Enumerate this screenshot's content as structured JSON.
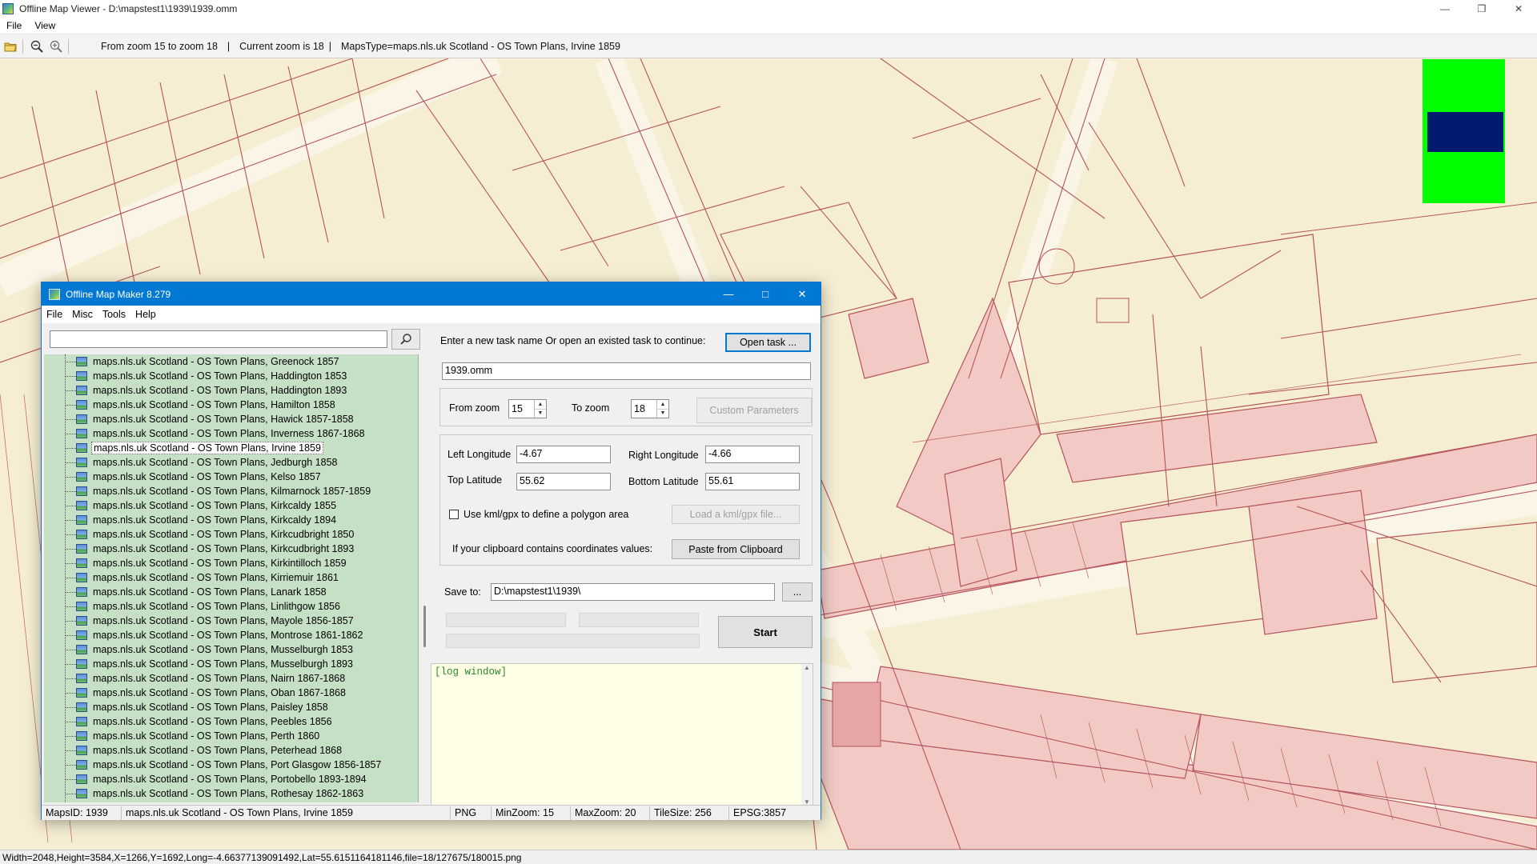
{
  "viewer": {
    "title": "Offline Map Viewer - D:\\mapstest1\\1939\\1939.omm",
    "menu": [
      "File",
      "View"
    ],
    "toolbar": {
      "zoom_range_text": "From zoom 15 to zoom 18",
      "current_zoom_text": "Current zoom is 18",
      "maps_type_text": "MapsType=maps.nls.uk Scotland - OS Town Plans, Irvine 1859",
      "separator": "|"
    },
    "status_bar": "Width=2048,Height=3584,X=1266,Y=1692,Long=-4.66377139091492,Lat=55.6151164181146,file=18/127675/180015.png"
  },
  "minimap": {
    "background_color": "#00ff00",
    "viewport_color": "#001a6e"
  },
  "dialog": {
    "title": "Offline Map Maker 8.279",
    "menu": [
      "File",
      "Misc",
      "Tools",
      "Help"
    ],
    "search": {
      "placeholder": "",
      "value": ""
    },
    "map_list": [
      "maps.nls.uk Scotland - OS Town Plans, Greenock 1857",
      "maps.nls.uk Scotland - OS Town Plans, Haddington 1853",
      "maps.nls.uk Scotland - OS Town Plans, Haddington 1893",
      "maps.nls.uk Scotland - OS Town Plans, Hamilton 1858",
      "maps.nls.uk Scotland - OS Town Plans, Hawick 1857-1858",
      "maps.nls.uk Scotland - OS Town Plans, Inverness 1867-1868",
      "maps.nls.uk Scotland - OS Town Plans, Irvine 1859",
      "maps.nls.uk Scotland - OS Town Plans, Jedburgh 1858",
      "maps.nls.uk Scotland - OS Town Plans, Kelso 1857",
      "maps.nls.uk Scotland - OS Town Plans, Kilmarnock 1857-1859",
      "maps.nls.uk Scotland - OS Town Plans, Kirkcaldy 1855",
      "maps.nls.uk Scotland - OS Town Plans, Kirkcaldy 1894",
      "maps.nls.uk Scotland - OS Town Plans, Kirkcudbright 1850",
      "maps.nls.uk Scotland - OS Town Plans, Kirkcudbright 1893",
      "maps.nls.uk Scotland - OS Town Plans, Kirkintilloch 1859",
      "maps.nls.uk Scotland - OS Town Plans, Kirriemuir 1861",
      "maps.nls.uk Scotland - OS Town Plans, Lanark 1858",
      "maps.nls.uk Scotland - OS Town Plans, Linlithgow 1856",
      "maps.nls.uk Scotland - OS Town Plans, Mayole 1856-1857",
      "maps.nls.uk Scotland - OS Town Plans, Montrose 1861-1862",
      "maps.nls.uk Scotland - OS Town Plans, Musselburgh 1853",
      "maps.nls.uk Scotland - OS Town Plans, Musselburgh 1893",
      "maps.nls.uk Scotland - OS Town Plans, Nairn 1867-1868",
      "maps.nls.uk Scotland - OS Town Plans, Oban 1867-1868",
      "maps.nls.uk Scotland - OS Town Plans, Paisley 1858",
      "maps.nls.uk Scotland - OS Town Plans, Peebles 1856",
      "maps.nls.uk Scotland - OS Town Plans, Perth 1860",
      "maps.nls.uk Scotland - OS Town Plans, Peterhead 1868",
      "maps.nls.uk Scotland - OS Town Plans, Port Glasgow 1856-1857",
      "maps.nls.uk Scotland - OS Town Plans, Portobello 1893-1894",
      "maps.nls.uk Scotland - OS Town Plans, Rothesay 1862-1863"
    ],
    "selected_map_index": 6,
    "task_prompt": "Enter a new task name Or open an existed task to continue:",
    "open_task_button": "Open task ...",
    "task_name_value": "1939.omm",
    "from_zoom_label": "From zoom",
    "from_zoom_value": "15",
    "to_zoom_label": "To zoom",
    "to_zoom_value": "18",
    "custom_parameters_button": "Custom Parameters",
    "left_longitude_label": "Left Longitude",
    "left_longitude_value": "-4.67",
    "right_longitude_label": "Right Longitude",
    "right_longitude_value": "-4.66",
    "top_latitude_label": "Top Latitude",
    "top_latitude_value": "55.62",
    "bottom_latitude_label": "Bottom Latitude",
    "bottom_latitude_value": "55.61",
    "kml_checkbox_label": "Use kml/gpx to define a polygon area",
    "kml_checked": false,
    "load_kml_button": "Load a kml/gpx file...",
    "clipboard_label": "If your clipboard contains coordinates values:",
    "paste_button": "Paste from Clipboard",
    "save_to_label": "Save to:",
    "save_to_value": "D:\\mapstest1\\1939\\",
    "browse_button": "...",
    "start_button": "Start",
    "log_text": "[log window]",
    "status": {
      "maps_id": "MapsID: 1939",
      "map_name": "maps.nls.uk Scotland - OS Town Plans, Irvine 1859",
      "format": "PNG",
      "min_zoom": "MinZoom: 15",
      "max_zoom": "MaxZoom: 20",
      "tile_size": "TileSize: 256",
      "epsg": "EPSG:3857"
    }
  }
}
